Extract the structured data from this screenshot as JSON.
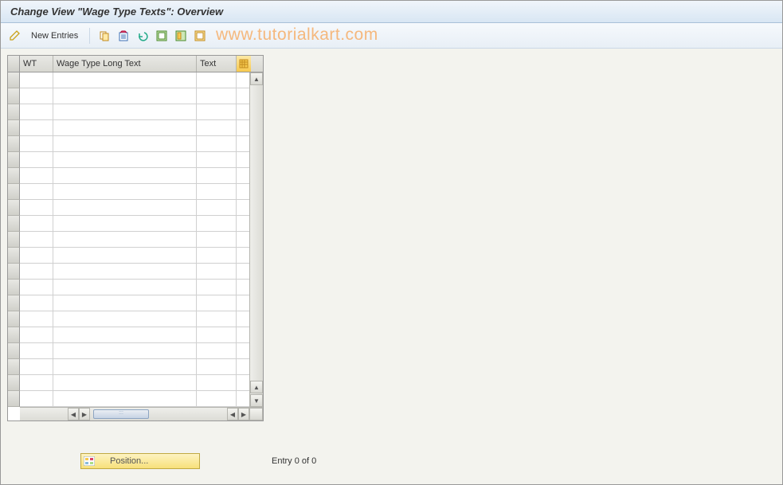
{
  "title": "Change View \"Wage Type Texts\": Overview",
  "watermark": "www.tutorialkart.com",
  "toolbar": {
    "new_entries_label": "New Entries"
  },
  "table": {
    "columns": {
      "wt": "WT",
      "long_text": "Wage Type Long Text",
      "text": "Text"
    },
    "row_count": 21,
    "rows": []
  },
  "footer": {
    "position_label": "Position...",
    "entry_text": "Entry 0 of 0"
  }
}
